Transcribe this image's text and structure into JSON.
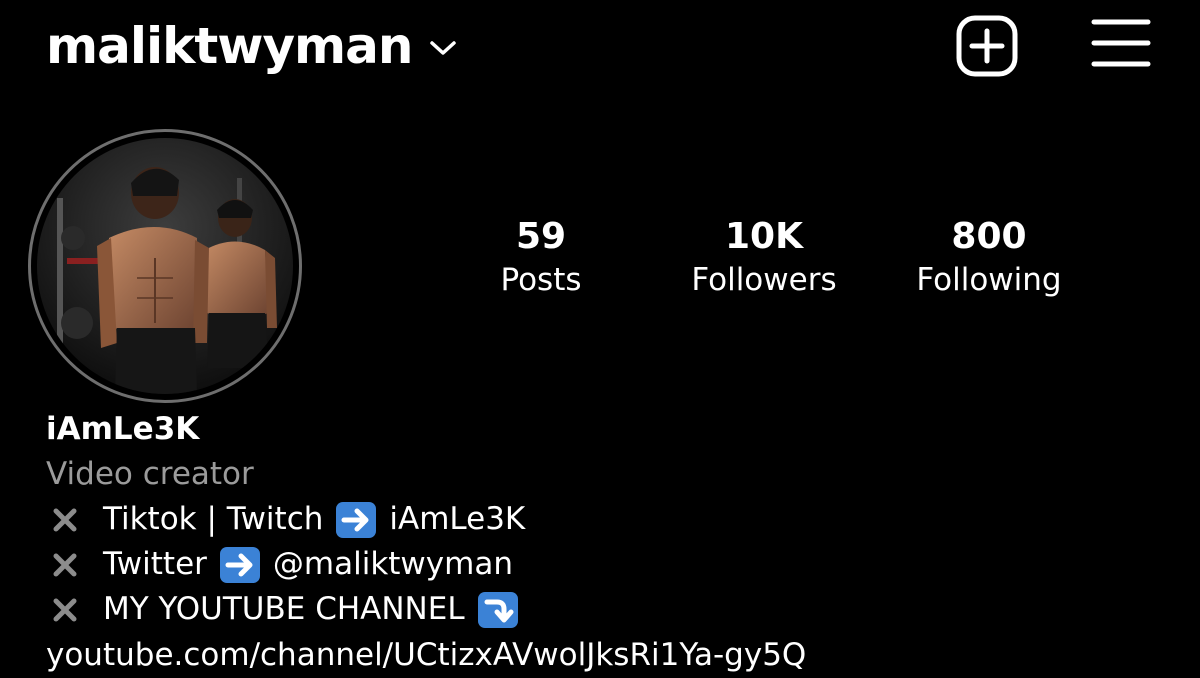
{
  "header": {
    "username": "maliktwyman",
    "icons": [
      "chevron-down-icon",
      "plus-square-icon",
      "hamburger-menu-icon"
    ]
  },
  "stats": [
    {
      "value": "59",
      "label": "Posts"
    },
    {
      "value": "10K",
      "label": "Followers"
    },
    {
      "value": "800",
      "label": "Following"
    }
  ],
  "bio": {
    "display_name": "iAmLe3K",
    "category": "Video creator",
    "lines": [
      {
        "icon": "heavy-x-icon",
        "text": "Tiktok | Twitch",
        "arrow_icon": "right-arrow-emoji-icon",
        "after": "iAmLe3K"
      },
      {
        "icon": "heavy-x-icon",
        "text": "Twitter",
        "arrow_icon": "right-arrow-emoji-icon",
        "after": "@maliktwyman"
      },
      {
        "icon": "heavy-x-icon",
        "text": "MY YOUTUBE CHANNEL",
        "arrow_icon": "curved-down-arrow-emoji-icon",
        "after": ""
      }
    ],
    "link": "youtube.com/channel/UCtizxAVwolJksRi1Ya-gy5Q"
  },
  "colors": {
    "background": "#000000",
    "text": "#ffffff",
    "secondary_text": "#9b9b9b",
    "avatar_ring": "#6e6e6e",
    "emoji_blue": "#3b82d6",
    "x_mark": "#8c8c8c"
  }
}
